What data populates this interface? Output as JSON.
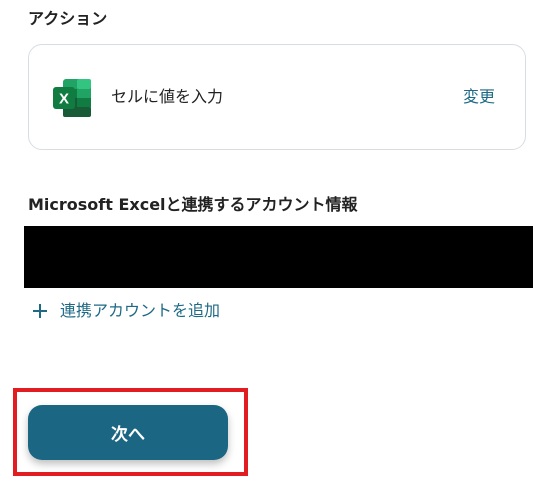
{
  "action_section": {
    "heading": "アクション",
    "card": {
      "app_icon": "microsoft-excel-icon",
      "app_icon_letter": "X",
      "action_label": "セルに値を入力",
      "change_label": "変更"
    }
  },
  "account_section": {
    "heading": "Microsoft Excelと連携するアカウント情報",
    "add_account_label": "連携アカウントを追加",
    "add_icon": "plus-icon"
  },
  "footer": {
    "next_label": "次へ"
  },
  "colors": {
    "accent": "#1b6783",
    "link": "#1e6a86",
    "highlight": "#e21d22",
    "excel_green": "#21a366"
  }
}
